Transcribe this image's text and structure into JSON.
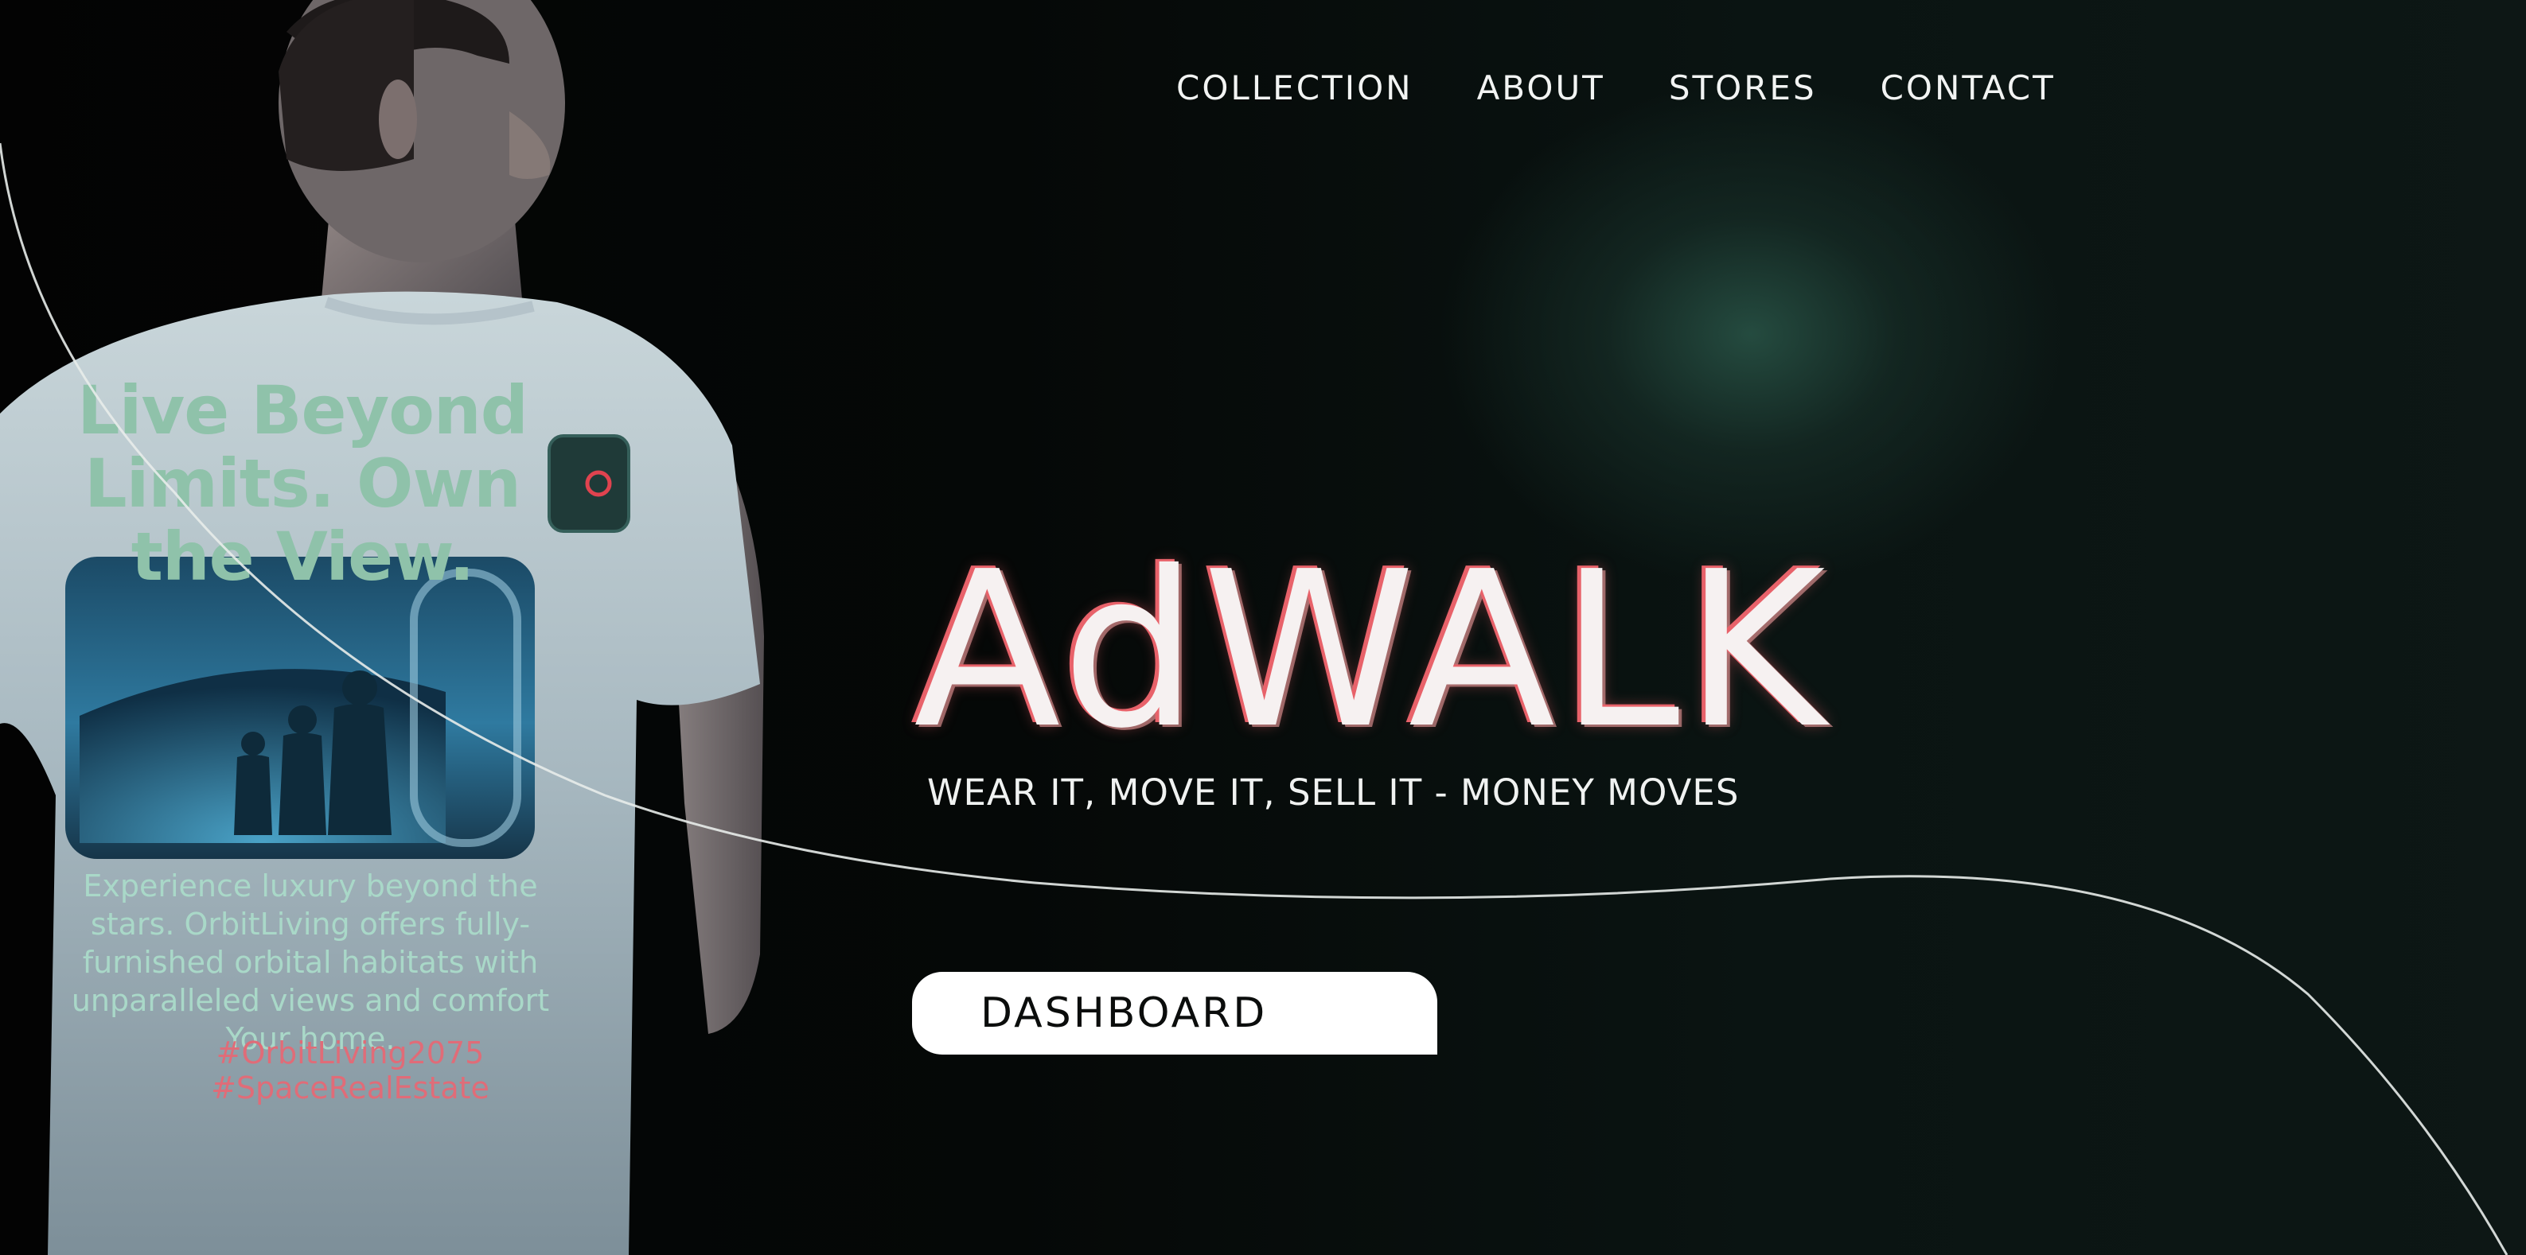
{
  "nav": {
    "items": [
      {
        "label": "COLLECTION"
      },
      {
        "label": "ABOUT"
      },
      {
        "label": "STORES"
      },
      {
        "label": "CONTACT"
      }
    ]
  },
  "hero": {
    "logo": "AdWALK",
    "tagline": "WEAR IT, MOVE IT, SELL IT - MONEY MOVES",
    "cta_label": "DASHBOARD"
  },
  "shirt": {
    "headline": "Live Beyond Limits. Own the View.",
    "body": "Experience luxury beyond the stars. OrbitLiving offers fully-furnished orbital habitats with unparalleled views and comfort  Your home.",
    "hashtags": [
      "#OrbitLiving2075",
      "#SpaceRealEstate"
    ]
  },
  "colors": {
    "background": "#050706",
    "accent_glow": "#264e42",
    "logo_outline": "#e8626a",
    "button_bg": "#ffffff",
    "shirt_text": "#8fc2aa",
    "hashtag": "#e06c78"
  }
}
